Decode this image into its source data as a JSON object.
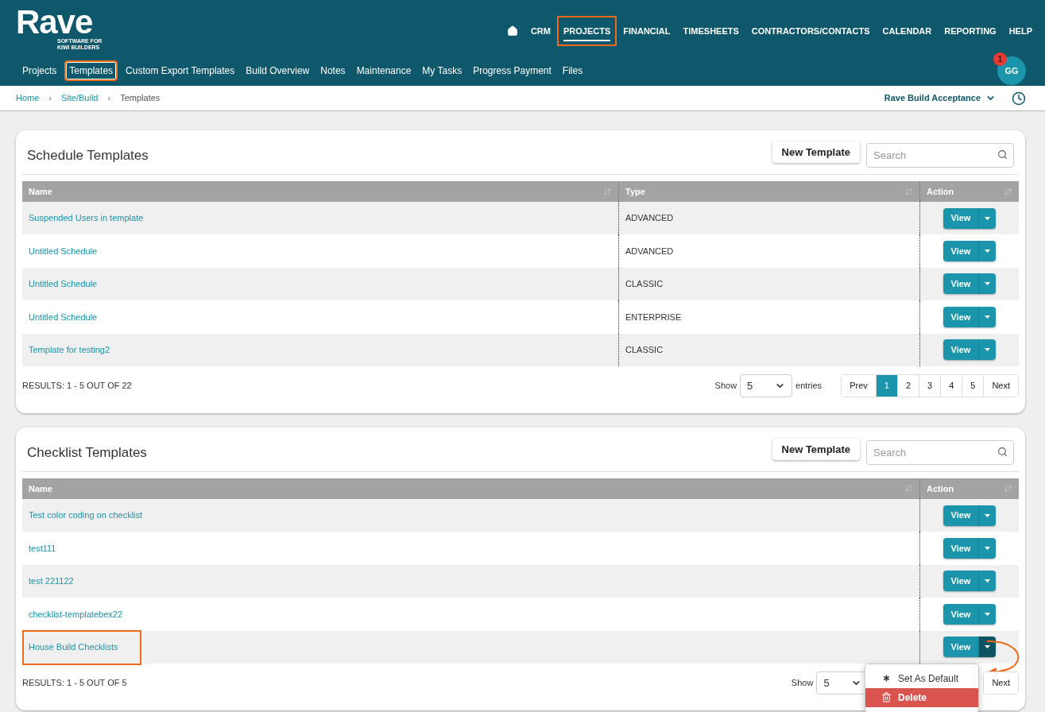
{
  "logo": {
    "name": "Rave",
    "tagline": [
      "SOFTWARE FOR",
      "KIWI BUILDERS"
    ]
  },
  "top_nav": [
    {
      "label": "CRM",
      "selected": false,
      "highlighted": false
    },
    {
      "label": "PROJECTS",
      "selected": true,
      "highlighted": true
    },
    {
      "label": "FINANCIAL",
      "selected": false,
      "highlighted": false
    },
    {
      "label": "TIMESHEETS",
      "selected": false,
      "highlighted": false
    },
    {
      "label": "CONTRACTORS/CONTACTS",
      "selected": false,
      "highlighted": false
    },
    {
      "label": "CALENDAR",
      "selected": false,
      "highlighted": false
    },
    {
      "label": "REPORTING",
      "selected": false,
      "highlighted": false
    },
    {
      "label": "HELP",
      "selected": false,
      "highlighted": false
    }
  ],
  "sub_nav": [
    {
      "label": "Projects",
      "selected": false
    },
    {
      "label": "Templates",
      "selected": true
    },
    {
      "label": "Custom Export Templates",
      "selected": false
    },
    {
      "label": "Build Overview",
      "selected": false
    },
    {
      "label": "Notes",
      "selected": false
    },
    {
      "label": "Maintenance",
      "selected": false
    },
    {
      "label": "My Tasks",
      "selected": false
    },
    {
      "label": "Progress Payment",
      "selected": false
    },
    {
      "label": "Files",
      "selected": false
    }
  ],
  "user": {
    "initials": "GG",
    "notifications": "1"
  },
  "breadcrumbs": [
    {
      "label": "Home"
    },
    {
      "separator": "›",
      "label": "Site/Build"
    },
    {
      "separator": "›",
      "label": "Templates"
    }
  ],
  "project_selector": "Rave Build Acceptance",
  "cards": [
    {
      "title": "Schedule Templates",
      "new_button": "New Template",
      "search": {
        "placeholder": "Search"
      },
      "columns": [
        "Name",
        "Type",
        "Action"
      ],
      "rows": [
        {
          "cells": [
            "Suspended Users in template",
            "ADVANCED"
          ],
          "view": "View",
          "highlighted": false,
          "menu_open": false
        },
        {
          "cells": [
            "Untitled Schedule",
            "ADVANCED"
          ],
          "view": "View",
          "highlighted": false,
          "menu_open": false
        },
        {
          "cells": [
            "Untitled Schedule",
            "CLASSIC"
          ],
          "view": "View",
          "highlighted": false,
          "menu_open": false
        },
        {
          "cells": [
            "Untitled Schedule",
            "ENTERPRISE"
          ],
          "view": "View",
          "highlighted": false,
          "menu_open": false
        },
        {
          "cells": [
            "Template for testing2",
            "CLASSIC"
          ],
          "view": "View",
          "highlighted": false,
          "menu_open": false
        }
      ],
      "results": "RESULTS: 1 - 5 OUT OF 22",
      "show_label": "Show",
      "page_size": "5",
      "entries_label": "entries",
      "pages": [
        {
          "label": "Prev",
          "selected": false
        },
        {
          "label": "1",
          "selected": true
        },
        {
          "label": "2",
          "selected": false
        },
        {
          "label": "3",
          "selected": false
        },
        {
          "label": "4",
          "selected": false
        },
        {
          "label": "5",
          "selected": false
        },
        {
          "label": "Next",
          "selected": false
        }
      ]
    },
    {
      "title": "Checklist Templates",
      "new_button": "New Template",
      "search": {
        "placeholder": "Search"
      },
      "columns": [
        "Name",
        "Action"
      ],
      "rows": [
        {
          "cells": [
            "Test color coding on checklist"
          ],
          "view": "View",
          "highlighted": false,
          "menu_open": false
        },
        {
          "cells": [
            "test111"
          ],
          "view": "View",
          "highlighted": false,
          "menu_open": false
        },
        {
          "cells": [
            "test 221122"
          ],
          "view": "View",
          "highlighted": false,
          "menu_open": false
        },
        {
          "cells": [
            "checklist-templatebex22"
          ],
          "view": "View",
          "highlighted": false,
          "menu_open": false
        },
        {
          "cells": [
            "House Build Checklists"
          ],
          "view": "View",
          "highlighted": true,
          "menu_open": true
        }
      ],
      "results": "RESULTS: 1 - 5 OUT OF 5",
      "show_label": "Show",
      "page_size": "5",
      "pages": [
        {
          "label": "Next",
          "selected": false
        }
      ],
      "menu": [
        {
          "label": "Set As Default",
          "kind": "default"
        },
        {
          "label": "Delete",
          "kind": "danger"
        }
      ]
    }
  ]
}
